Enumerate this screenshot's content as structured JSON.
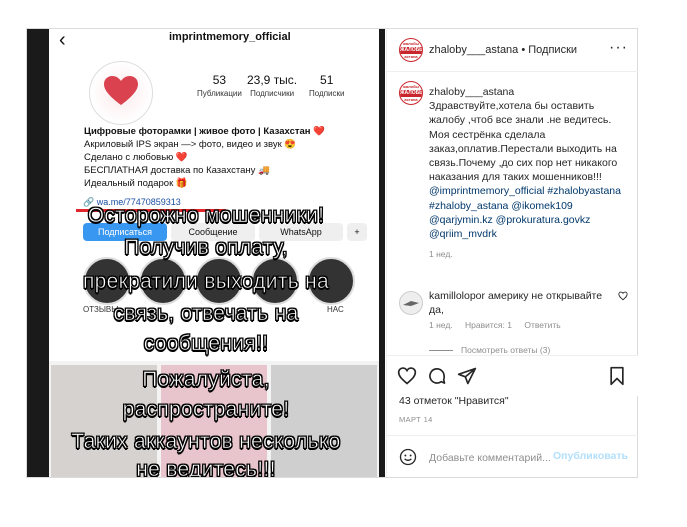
{
  "media": {
    "profile_username": "imprintmemory_official",
    "posts_count": "53",
    "posts_label": "Публикации",
    "followers_count": "23,9 тыс.",
    "followers_label": "Подписчики",
    "following_count": "51",
    "following_label": "Подписки",
    "bio": [
      "Цифровые фоторамки | живое фото | Казахстан ❤️",
      "Акриловый IPS экран —> фото, видео и звук 😍",
      "Сделано с любовью ❤️",
      "БЕСПЛАТНАЯ доставка по Казахстану 🚚",
      "Идеальный подарок 🎁"
    ],
    "link": "wa.me/77470859313",
    "follow_btn": "Подписаться",
    "message_btn": "Сообщение",
    "whatsapp_btn": "WhatsApp",
    "story_label_1": "ОТЗЫВЫ",
    "story_label_2": "НАС",
    "overlay_line1": "Осторожно мошенники!",
    "overlay_line2": "Получив оплату,",
    "overlay_line3": "прекратили выходить на",
    "overlay_line4": "связь, отвечать на",
    "overlay_line5": "сообщения!!",
    "overlay_line6": "Пожалуйста,",
    "overlay_line7": "распространите!",
    "overlay_line8": "Таких аккаунтов несколько",
    "overlay_line9": "не ведитесь!!!"
  },
  "header": {
    "username": "zhaloby___astana",
    "separator": " • ",
    "follow_label": "Подписки",
    "more_icon": "more-icon",
    "logo_text_top": "жалобы",
    "logo_text_main": "ЖАЛОБЫ",
    "logo_text_bottom": "астана"
  },
  "caption": {
    "username": "zhaloby___astana",
    "text": "Здравствуйте,хотела бы оставить жалобу ,чтоб все знали .не ведитесь. Моя сестрёнка сделала заказ,оплатив.Перестали выходить на связь.Почему ,до сих пор нет никакого наказания для таких мошенников!!!",
    "tags": "@imprintmemory_official #zhalobyastana #zhaloby_astana @ikomek109 @qarjymin.kz @prokuratura.govkz @qriim_mvdrk",
    "time": "1 нед."
  },
  "comment": {
    "username": "kamillolopor",
    "text": "америку не открывайте да,",
    "time": "1 нед.",
    "likes": "Нравится: 1",
    "reply": "Ответить",
    "view_replies": "Посмотреть ответы (3)"
  },
  "actions": {
    "likes_text": "43 отметок \"Нравится\"",
    "date": "МАРТ 14"
  },
  "add_comment": {
    "placeholder": "Добавьте комментарий...",
    "publish": "Опубликовать"
  },
  "colors": {
    "accent_red": "#c9252c",
    "link_blue": "#00376b",
    "publish_disabled": "#b2dffc"
  }
}
